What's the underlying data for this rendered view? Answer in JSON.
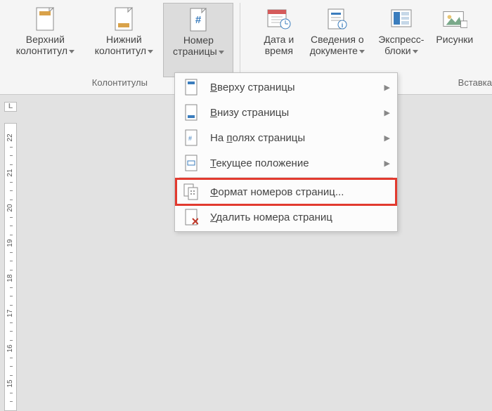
{
  "ribbon": {
    "group1": {
      "label": "Колонтитулы",
      "btn_header": {
        "line1": "Верхний",
        "line2": "колонтитул"
      },
      "btn_footer": {
        "line1": "Нижний",
        "line2": "колонтитул"
      },
      "btn_pagenum": {
        "line1": "Номер",
        "line2": "страницы"
      }
    },
    "group2": {
      "label": "Вставка",
      "btn_datetime": {
        "line1": "Дата и",
        "line2": "время"
      },
      "btn_docinfo": {
        "line1": "Сведения о",
        "line2": "документе"
      },
      "btn_quickparts": {
        "line1": "Экспресс-",
        "line2": "блоки"
      },
      "btn_pictures": {
        "line1": "Рисунки"
      }
    }
  },
  "menu": {
    "top": "Вверху страницы",
    "bottom": "Внизу страницы",
    "margins": "На полях страницы",
    "current": "Текущее положение",
    "format": "Формат номеров страниц...",
    "remove": "Удалить номера страниц"
  },
  "menu_accel": {
    "top": "В",
    "bottom": "В",
    "margins": "п",
    "current": "Т",
    "format": "Ф",
    "remove": "У"
  },
  "ruler_ticks": [
    "22",
    "21",
    "20",
    "19",
    "18",
    "17",
    "16",
    "15"
  ],
  "colors": {
    "accent_blue": "#3b7dbd",
    "accent_orange": "#d9a24a",
    "highlight_red": "#e23a2f"
  }
}
